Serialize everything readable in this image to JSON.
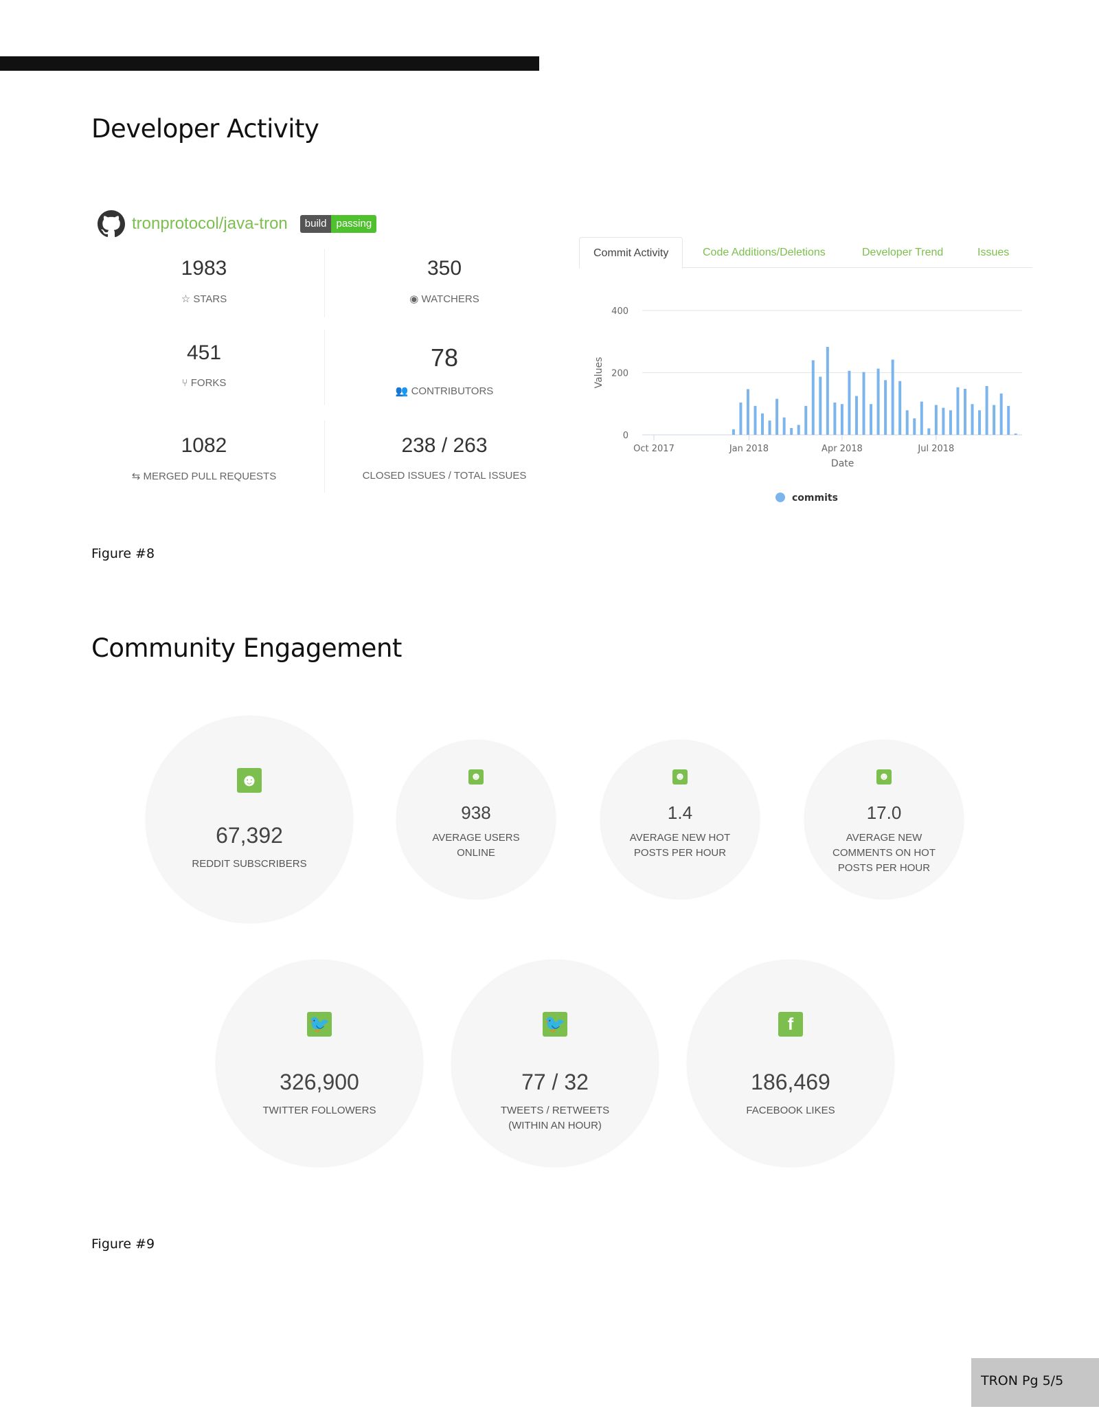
{
  "dev": {
    "title": "Developer Activity",
    "repo": "tronprotocol/java-tron",
    "badge": {
      "left": "build",
      "right": "passing"
    },
    "stats": [
      {
        "value": "1983",
        "label": "STARS",
        "icon": "star-icon"
      },
      {
        "value": "350",
        "label": "WATCHERS",
        "icon": "eye-icon"
      },
      {
        "value": "451",
        "label": "FORKS",
        "icon": "fork-icon"
      },
      {
        "value": "78",
        "label": "CONTRIBUTORS",
        "icon": "users-icon"
      },
      {
        "value": "1082",
        "label": "MERGED PULL REQUESTS",
        "icon": "merge-icon"
      },
      {
        "value": "238 / 263",
        "label": "CLOSED ISSUES / TOTAL ISSUES"
      }
    ],
    "tabs": [
      "Commit Activity",
      "Code Additions/Deletions",
      "Developer Trend",
      "Issues"
    ],
    "figure": "Figure #8"
  },
  "chart_data": {
    "type": "bar",
    "xlabel": "Date",
    "ylabel": "Values",
    "ylim": [
      0,
      400
    ],
    "yticks": [
      "0",
      "200",
      "400"
    ],
    "xticks": [
      {
        "date": "2017-10-01",
        "label": "Oct 2017"
      },
      {
        "date": "2018-01-01",
        "label": "Jan 2018"
      },
      {
        "date": "2018-04-01",
        "label": "Apr 2018"
      },
      {
        "date": "2018-07-01",
        "label": "Jul 2018"
      }
    ],
    "legend": "bottom",
    "grid": true,
    "series": [
      {
        "name": "commits",
        "color": "#7cb5ec",
        "x": [
          "2017-12-17",
          "2017-12-24",
          "2017-12-31",
          "2018-01-07",
          "2018-01-14",
          "2018-01-21",
          "2018-01-28",
          "2018-02-04",
          "2018-02-11",
          "2018-02-18",
          "2018-02-25",
          "2018-03-04",
          "2018-03-11",
          "2018-03-18",
          "2018-03-25",
          "2018-04-01",
          "2018-04-08",
          "2018-04-15",
          "2018-04-22",
          "2018-04-29",
          "2018-05-06",
          "2018-05-13",
          "2018-05-20",
          "2018-05-27",
          "2018-06-03",
          "2018-06-10",
          "2018-06-17",
          "2018-06-24",
          "2018-07-01",
          "2018-07-08",
          "2018-07-15",
          "2018-07-22",
          "2018-07-29",
          "2018-08-05",
          "2018-08-12",
          "2018-08-19",
          "2018-08-26",
          "2018-09-02",
          "2018-09-09",
          "2018-09-16"
        ],
        "values": [
          18,
          104,
          147,
          93,
          69,
          46,
          116,
          56,
          22,
          32,
          93,
          240,
          187,
          283,
          104,
          99,
          206,
          125,
          202,
          99,
          213,
          176,
          242,
          173,
          79,
          53,
          107,
          21,
          96,
          87,
          79,
          153,
          148,
          99,
          79,
          157,
          96,
          133,
          93,
          4
        ]
      }
    ]
  },
  "community": {
    "title": "Community Engagement",
    "row1": [
      {
        "value": "67,392",
        "label": "REDDIT SUBSCRIBERS",
        "icon": "reddit-icon"
      },
      {
        "value": "938",
        "label": "AVERAGE USERS ONLINE",
        "icon": "reddit-icon"
      },
      {
        "value": "1.4",
        "label": "AVERAGE NEW HOT POSTS PER HOUR",
        "icon": "reddit-icon"
      },
      {
        "value": "17.0",
        "label": "AVERAGE NEW COMMENTS ON HOT POSTS PER HOUR",
        "icon": "reddit-icon"
      }
    ],
    "row2": [
      {
        "value": "326,900",
        "label": "TWITTER FOLLOWERS",
        "icon": "twitter-icon"
      },
      {
        "value": "77 / 32",
        "label": "TWEETS / RETWEETS (WITHIN AN HOUR)",
        "icon": "twitter-icon"
      },
      {
        "value": "186,469",
        "label": "FACEBOOK LIKES",
        "icon": "facebook-icon"
      }
    ],
    "figure": "Figure #9"
  },
  "footer": "TRON Pg 5/5"
}
